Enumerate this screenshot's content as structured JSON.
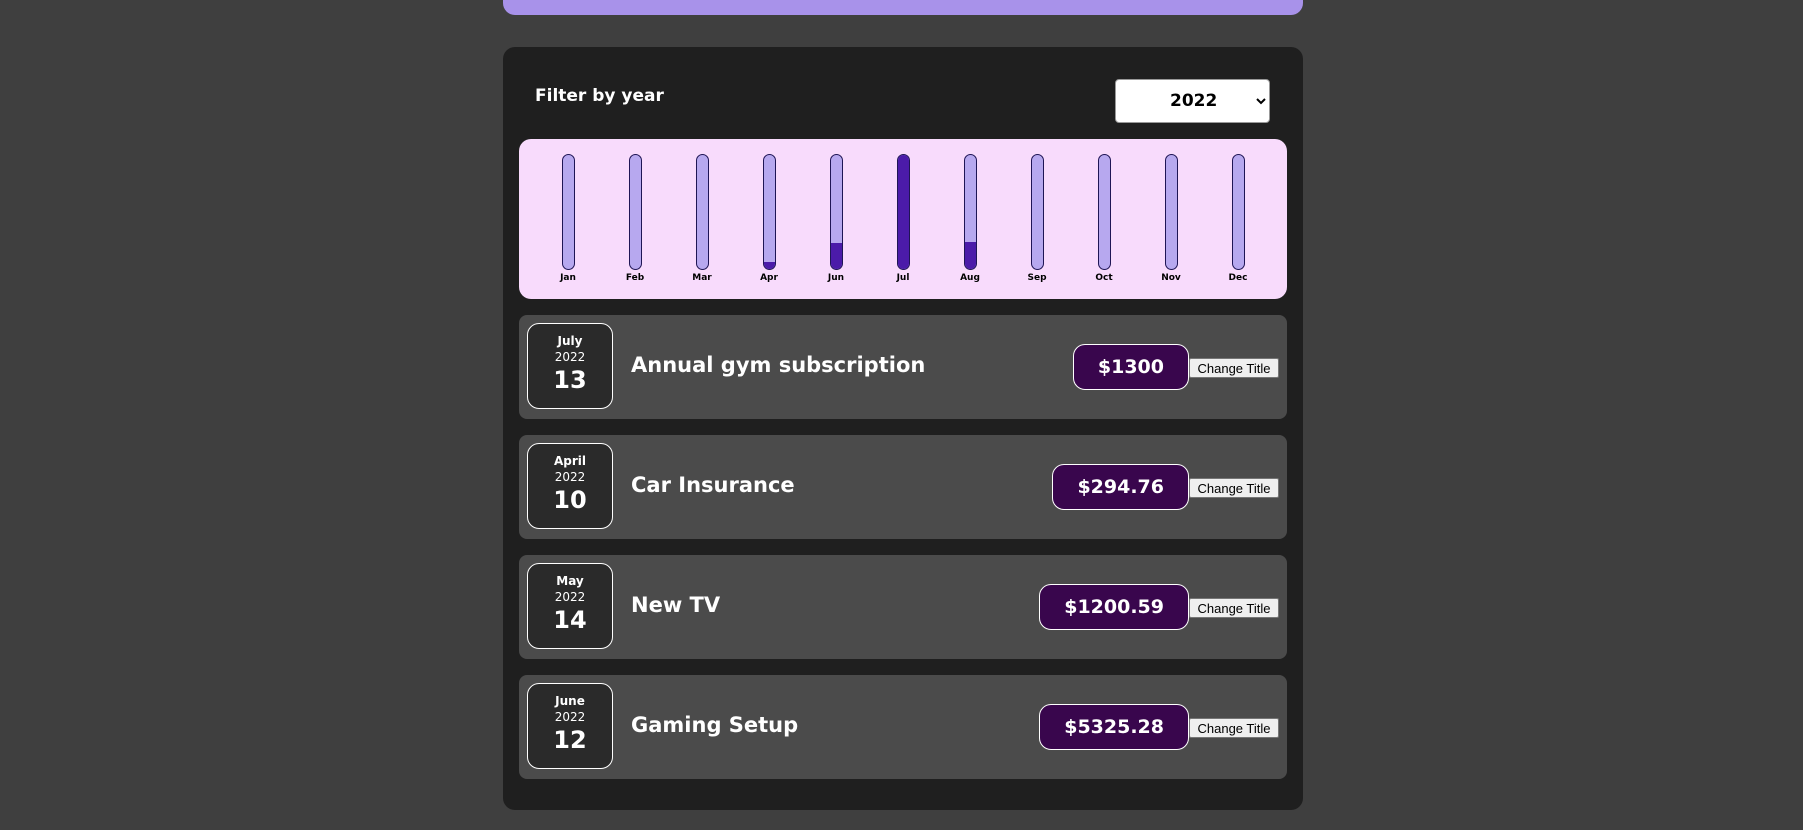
{
  "filter": {
    "label": "Filter by year",
    "selected_year": "2022",
    "year_options": [
      "2022"
    ]
  },
  "chart_data": {
    "type": "bar",
    "categories": [
      "Jan",
      "Feb",
      "Mar",
      "Apr",
      "Jun",
      "Jul",
      "Aug",
      "Sep",
      "Oct",
      "Nov",
      "Dec"
    ],
    "values": [
      0,
      0,
      0,
      0.06,
      0.23,
      1.0,
      0.24,
      0,
      0,
      0,
      0
    ],
    "ylim": [
      0,
      1
    ]
  },
  "expenses": [
    {
      "month": "July",
      "year": "2022",
      "day": "13",
      "title": "Annual gym subscription",
      "price": "$1300",
      "button_label": "Change Title"
    },
    {
      "month": "April",
      "year": "2022",
      "day": "10",
      "title": "Car Insurance",
      "price": "$294.76",
      "button_label": "Change Title"
    },
    {
      "month": "May",
      "year": "2022",
      "day": "14",
      "title": "New TV",
      "price": "$1200.59",
      "button_label": "Change Title"
    },
    {
      "month": "June",
      "year": "2022",
      "day": "12",
      "title": "Gaming Setup",
      "price": "$5325.28",
      "button_label": "Change Title"
    }
  ],
  "colors": {
    "accent": "#a892ea",
    "chart_background": "#f8dbfc",
    "bar_track": "#b7a8ef",
    "bar_fill": "#4b1ba9",
    "price_background": "#39064d"
  }
}
